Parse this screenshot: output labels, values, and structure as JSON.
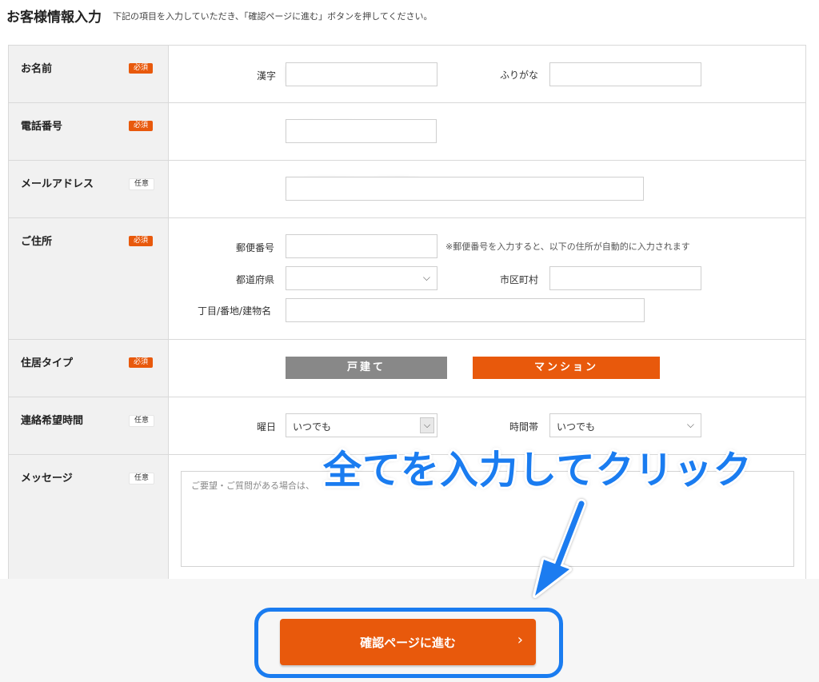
{
  "header": {
    "title": "お客様情報入力",
    "subtitle": "下記の項目を入力していただき、「確認ページに進む」ボタンを押してください。"
  },
  "badges": {
    "required": "必須",
    "optional": "任意"
  },
  "fields": {
    "name": {
      "label": "お名前",
      "kanji_label": "漢字",
      "kana_label": "ふりがな"
    },
    "phone": {
      "label": "電話番号"
    },
    "email": {
      "label": "メールアドレス"
    },
    "address": {
      "label": "ご住所",
      "postal_label": "郵便番号",
      "postal_note": "※郵便番号を入力すると、以下の住所が自動的に入力されます",
      "prefecture_label": "都道府県",
      "city_label": "市区町村",
      "street_label": "丁目/番地/建物名"
    },
    "residence_type": {
      "label": "住居タイプ",
      "option_house": "戸建て",
      "option_mansion": "マンション"
    },
    "contact_time": {
      "label": "連絡希望時間",
      "day_label": "曜日",
      "day_value": "いつでも",
      "time_label": "時間帯",
      "time_value": "いつでも"
    },
    "message": {
      "label": "メッセージ",
      "placeholder": "ご要望・ご質問がある場合は、"
    }
  },
  "submit": {
    "label": "確認ページに進む",
    "chevron": "›"
  },
  "annotation": {
    "text": "全てを入力してクリック",
    "color": "#1a7cf0"
  },
  "colors": {
    "accent": "#e8590c",
    "gray_button": "#888888",
    "annotation_blue": "#1a7cf0"
  }
}
